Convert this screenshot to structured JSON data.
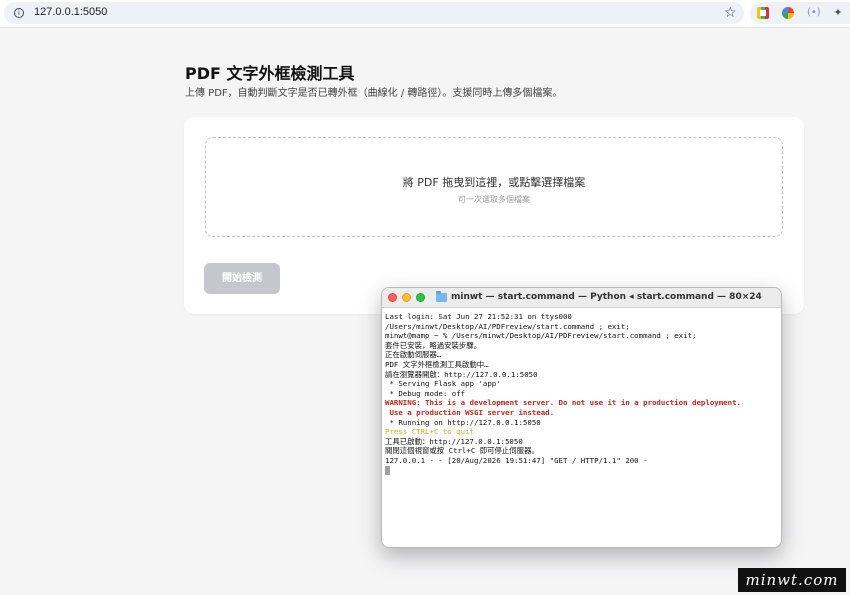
{
  "browser": {
    "url": "127.0.0.1:5050",
    "info_glyph": "i",
    "star_glyph": "☆",
    "extensions": [
      {
        "icon": "colorful-square-icon",
        "glyph": ""
      },
      {
        "icon": "colorful-circle-icon",
        "glyph": ""
      },
      {
        "icon": "wave-icon",
        "glyph": "(•)"
      },
      {
        "icon": "puzzle-icon",
        "glyph": "✦"
      }
    ]
  },
  "page": {
    "title": "PDF 文字外框檢測工具",
    "subtitle": "上傳 PDF，自動判斷文字是否已轉外框（曲線化 / 轉路徑）。支援同時上傳多個檔案。",
    "dropzone": {
      "main": "將 PDF 拖曳到這裡，或點擊選擇檔案",
      "sub": "可一次選取多個檔案"
    },
    "start_label": "開始檢測"
  },
  "terminal": {
    "title": "minwt — start.command — Python ◂ start.command — 80×24",
    "lines": [
      {
        "text": "Last login: Sat Jun 27 21:52:31 on ttys000",
        "style": "normal"
      },
      {
        "text": "/Users/minwt/Desktop/AI/PDFreview/start.command ; exit;",
        "style": "normal"
      },
      {
        "text": "minwt@mamp ~ % /Users/minwt/Desktop/AI/PDFreview/start.command ; exit;",
        "style": "normal"
      },
      {
        "text": "套件已安裝，略過安裝步驟。",
        "style": "normal"
      },
      {
        "text": "正在啟動伺服器…",
        "style": "normal"
      },
      {
        "text": "PDF 文字外框檢測工具啟動中…",
        "style": "normal"
      },
      {
        "text": "請在瀏覽器開啟：http://127.0.0.1:5050",
        "style": "normal"
      },
      {
        "text": " * Serving Flask app 'app'",
        "style": "normal"
      },
      {
        "text": " * Debug mode: off",
        "style": "normal"
      },
      {
        "text": "WARNING: This is a development server. Do not use it in a production deployment.",
        "style": "warn"
      },
      {
        "text": " Use a production WSGI server instead.",
        "style": "warn"
      },
      {
        "text": " * Running on http://127.0.0.1:5050",
        "style": "normal"
      },
      {
        "text": "Press CTRL+C to quit",
        "style": "hint"
      },
      {
        "text": "工具已啟動：http://127.0.0.1:5050",
        "style": "normal"
      },
      {
        "text": "關閉這個視窗或按 Ctrl+C 即可停止伺服器。",
        "style": "normal"
      },
      {
        "text": "127.0.0.1 - - [20/Aug/2026 19:51:47] \"GET / HTTP/1.1\" 200 -",
        "style": "normal"
      }
    ]
  },
  "watermark": "minwt.com",
  "colors": {
    "warning_text": "#c4231b",
    "hint_text": "#b6b41c",
    "button_disabled": "#c5c7cc"
  }
}
